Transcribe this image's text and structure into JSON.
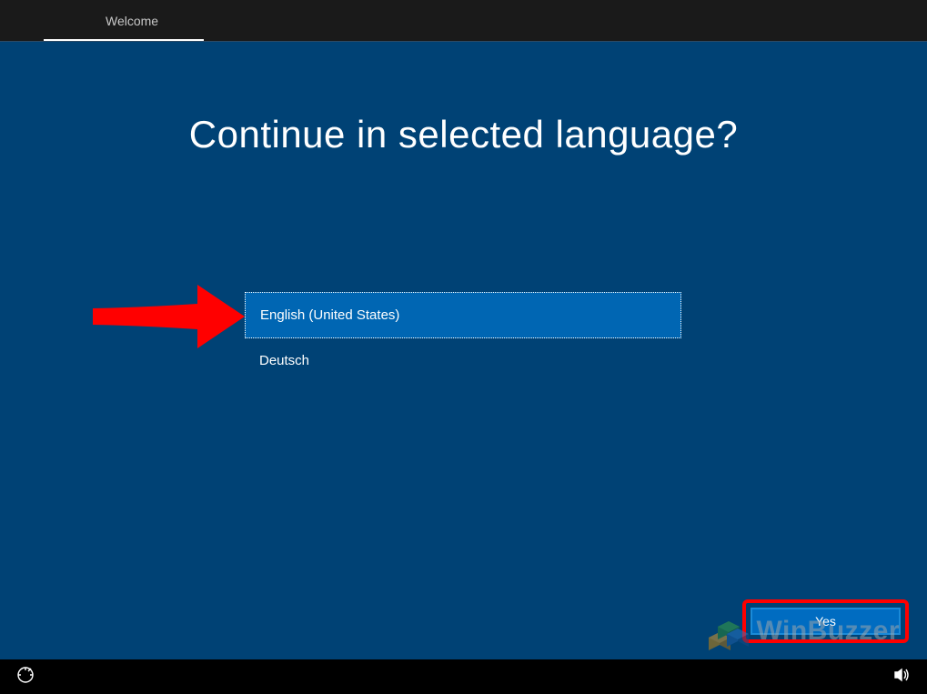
{
  "tab": {
    "label": "Welcome"
  },
  "heading": "Continue in selected language?",
  "languages": [
    {
      "label": "English (United States)",
      "selected": true
    },
    {
      "label": "Deutsch",
      "selected": false
    }
  ],
  "yes_button": "Yes",
  "watermark": "WinBuzzer"
}
